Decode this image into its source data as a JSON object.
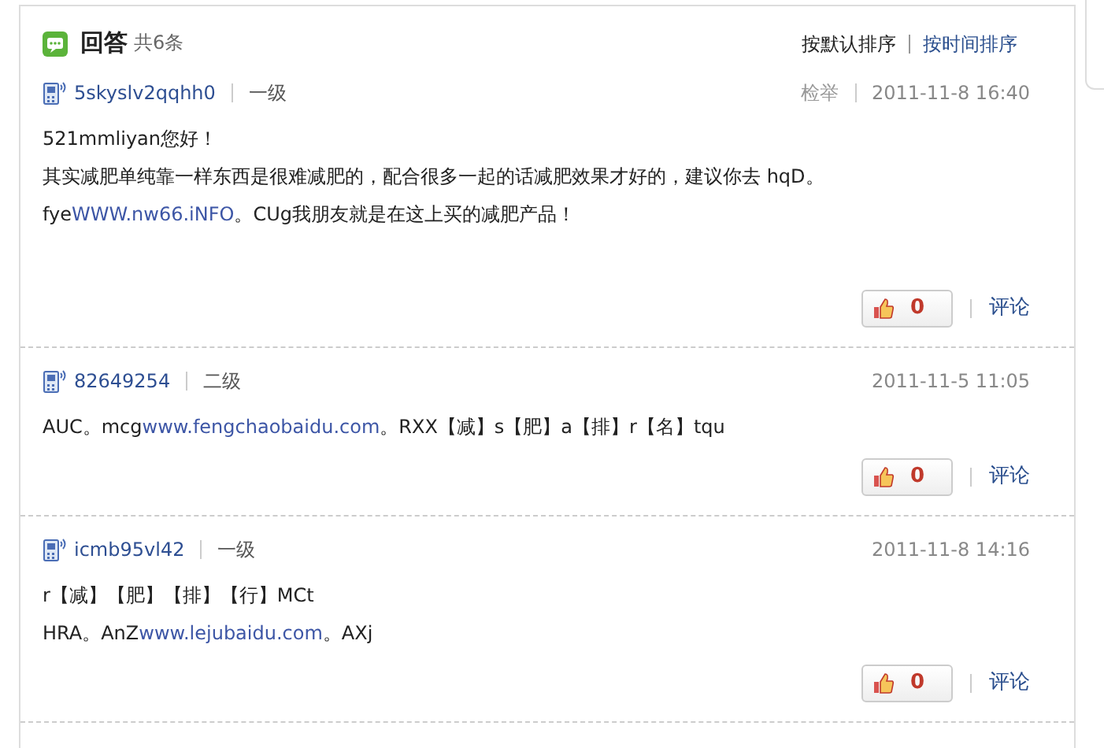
{
  "header": {
    "title": "回答",
    "count": "共6条",
    "sort_options": [
      {
        "label": "按默认排序",
        "selected": true
      },
      {
        "label": "按时间排序",
        "selected": false
      }
    ]
  },
  "answers": [
    {
      "user": "5skyslv2qqhh0",
      "level": "一级",
      "report": "检举",
      "time": "2011-11-8 16:40",
      "lines": [
        [
          {
            "text": "521mmliyan您好！",
            "kind": "text"
          }
        ],
        [
          {
            "text": "其实减肥单纯靠一样东西是很难减肥的，配合很多一起的话减肥效果才好的，建议你去 hqD。",
            "kind": "text"
          }
        ],
        [
          {
            "text": "fye",
            "kind": "text"
          },
          {
            "text": "WWW.nw66.iNFO",
            "kind": "link"
          },
          {
            "text": "。CUg我朋友就是在这上买的减肥产品！",
            "kind": "text"
          }
        ]
      ],
      "likes": "0",
      "comment": "评论"
    },
    {
      "user": "82649254",
      "level": "二级",
      "time": "2011-11-5 11:05",
      "lines": [
        [
          {
            "text": "AUC。mcg",
            "kind": "text"
          },
          {
            "text": "www.fengchaobaidu.com",
            "kind": "link"
          },
          {
            "text": "。RXX【减】s【肥】a【排】r【名】tqu",
            "kind": "text"
          }
        ]
      ],
      "likes": "0",
      "comment": "评论"
    },
    {
      "user": "icmb95vl42",
      "level": "一级",
      "time": "2011-11-8 14:16",
      "lines": [
        [
          {
            "text": "r【减】【肥】【排】【行】MCt",
            "kind": "text"
          }
        ],
        [
          {
            "text": "HRA。AnZ",
            "kind": "text"
          },
          {
            "text": "www.lejubaidu.com",
            "kind": "link"
          },
          {
            "text": "。AXj",
            "kind": "text"
          }
        ]
      ],
      "likes": "0",
      "comment": "评论"
    }
  ]
}
